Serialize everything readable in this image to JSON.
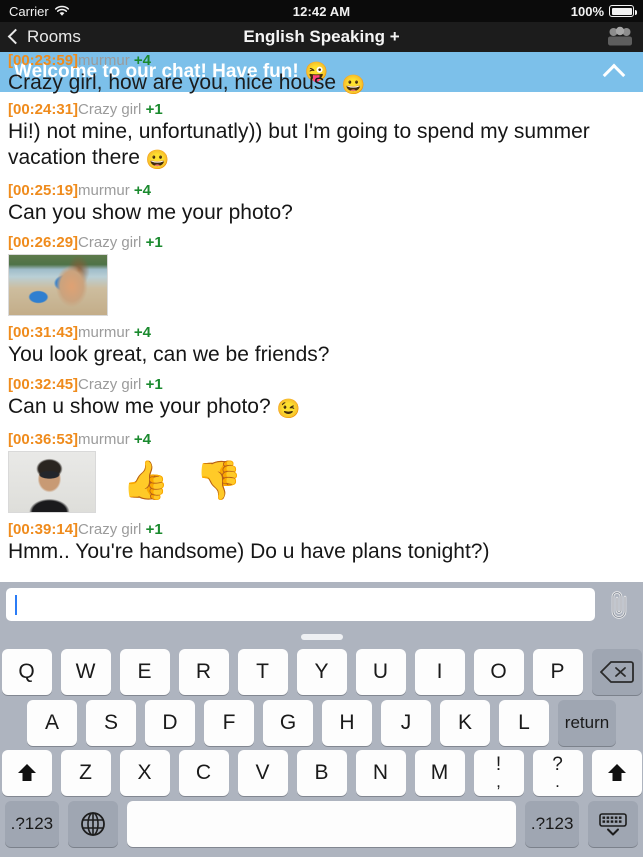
{
  "status_bar": {
    "carrier": "Carrier",
    "wifi_icon": "wifi-icon",
    "time": "12:42 AM",
    "battery_percent": "100%",
    "battery_icon": "battery-full-icon"
  },
  "nav_bar": {
    "back_label": "Rooms",
    "back_icon": "chevron-left-icon",
    "title": "English Speaking +",
    "members_icon": "group-members-icon"
  },
  "banner": {
    "text": "Welcome to our chat! Have fun!",
    "emoji": "😜",
    "collapse_icon": "chevron-up-icon",
    "color": "#7cc0ea"
  },
  "occluded_message": {
    "time": "[00:23:59]",
    "user": "murmur",
    "rank": "+4",
    "text": "Crazy girl, how are you, nice house",
    "emoji": "😀"
  },
  "messages": [
    {
      "time": "[00:24:31]",
      "user": "Crazy girl",
      "rank": "+1",
      "text": "Hi!) not mine, unfortunatly)) but I'm going to spend my summer vacation there",
      "emoji": "😀",
      "type": "text"
    },
    {
      "time": "[00:25:19]",
      "user": "murmur",
      "rank": "+4",
      "text": "Can you show me your photo?",
      "emoji": "",
      "type": "text"
    },
    {
      "time": "[00:26:29]",
      "user": "Crazy girl",
      "rank": "+1",
      "text": "",
      "emoji": "",
      "type": "photo",
      "photo_name": "beach-photo-thumbnail"
    },
    {
      "time": "[00:31:43]",
      "user": "murmur",
      "rank": "+4",
      "text": "You look great, can we be friends?",
      "emoji": "",
      "type": "text"
    },
    {
      "time": "[00:32:45]",
      "user": "Crazy girl",
      "rank": "+1",
      "text": "Can u show me your photo?",
      "emoji": "😉",
      "type": "text"
    },
    {
      "time": "[00:36:53]",
      "user": "murmur",
      "rank": "+4",
      "text": "",
      "emoji": "",
      "type": "photo_vote",
      "photo_name": "portrait-photo-thumbnail",
      "thumbs_up": "👍",
      "thumbs_down": "👎"
    },
    {
      "time": "[00:39:14]",
      "user": "Crazy girl",
      "rank": "+1",
      "text": "Hmm.. You're handsome) Do u have plans tonight?)",
      "emoji": "",
      "type": "text"
    }
  ],
  "input_bar": {
    "value": "",
    "placeholder": "",
    "attach_icon": "paperclip-icon"
  },
  "keyboard": {
    "drag_handle": "keyboard-drag-handle",
    "row1": [
      "Q",
      "W",
      "E",
      "R",
      "T",
      "Y",
      "U",
      "I",
      "O",
      "P"
    ],
    "delete_icon": "delete-backspace-icon",
    "row2": [
      "A",
      "S",
      "D",
      "F",
      "G",
      "H",
      "J",
      "K",
      "L"
    ],
    "return_label": "return",
    "row3": [
      "Z",
      "X",
      "C",
      "V",
      "B",
      "N",
      "M"
    ],
    "shift_icon": "shift-arrow-icon",
    "punct1_top": "!",
    "punct1_bottom": ",",
    "punct2_top": "?",
    "punct2_bottom": ".",
    "numbers_label": ".?123",
    "globe_icon": "globe-language-icon",
    "space_label": "",
    "hide_keyboard_icon": "hide-keyboard-icon"
  },
  "colors": {
    "timestamp": "#ef8b1c",
    "username": "#9b9b9b",
    "rank": "#1a8a2e",
    "banner": "#7cc0ea",
    "keyboard_bg": "#aeb4bf"
  }
}
